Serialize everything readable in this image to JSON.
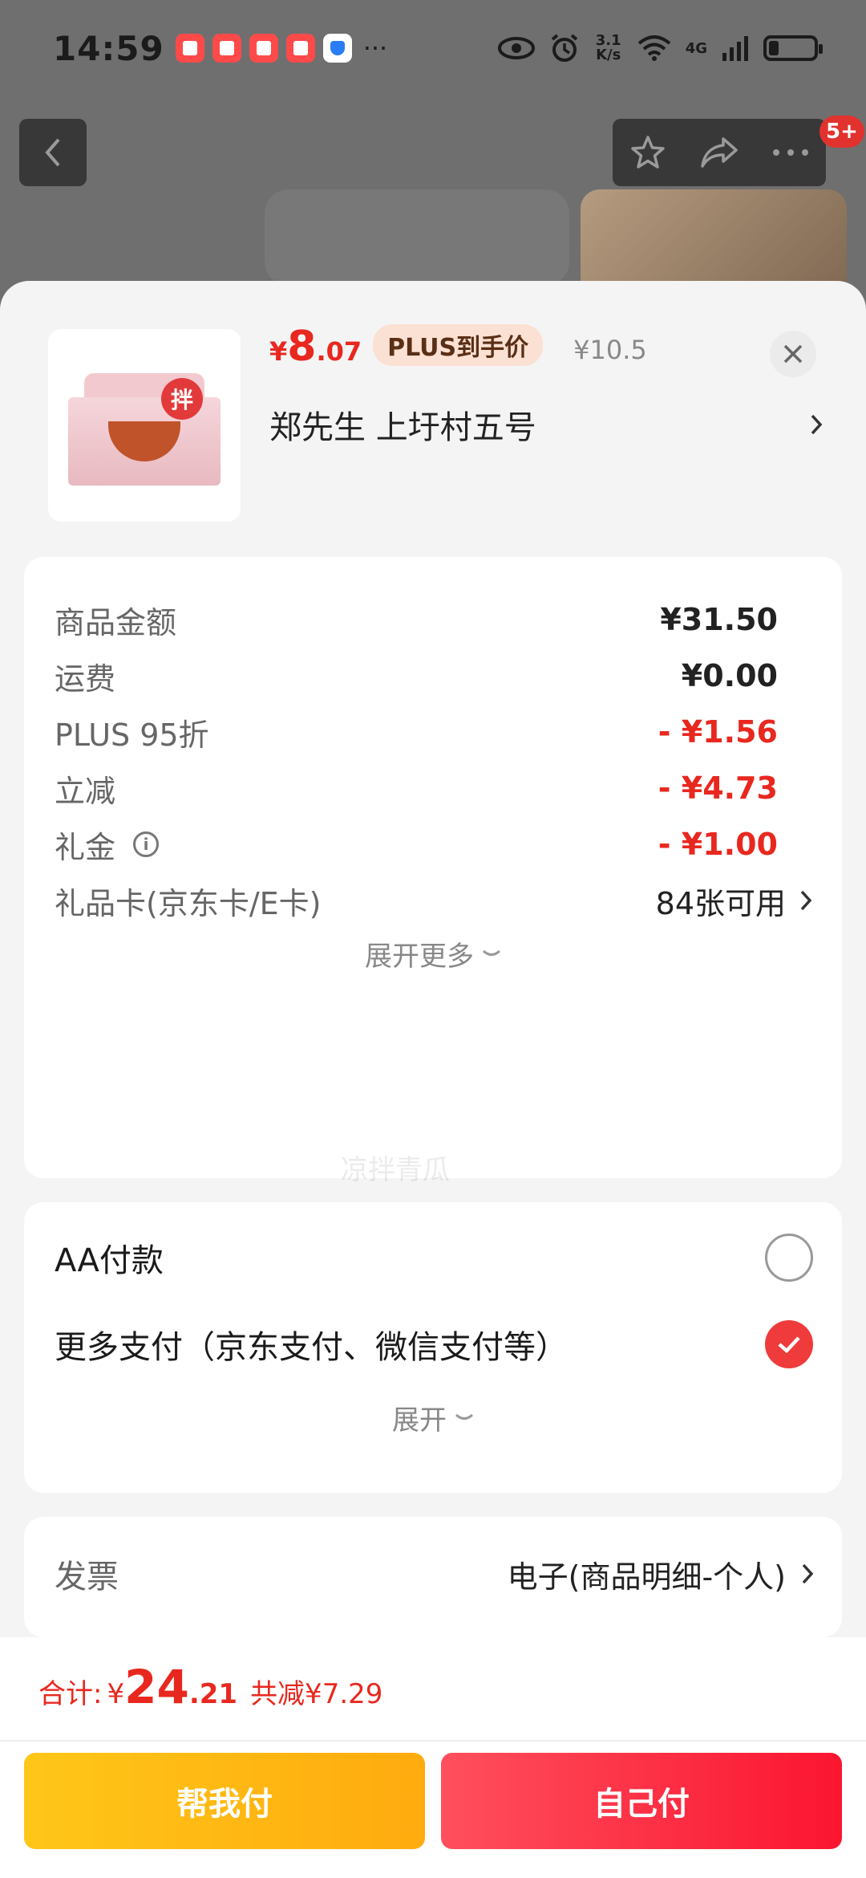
{
  "status_bar": {
    "time": "14:59",
    "more": "···",
    "net_speed": "3.1 K/s",
    "network": "4G"
  },
  "background": {
    "badge": "5+"
  },
  "product": {
    "price_symbol": "¥",
    "price_int": "8",
    "price_dec": ".07",
    "plus_tag": "PLUS到手价",
    "original_price": "¥10.5",
    "address": "郑先生  上圩村五号",
    "seal_text": "拌"
  },
  "summary": {
    "rows": [
      {
        "label": "商品金额",
        "value": "¥31.50"
      },
      {
        "label": "运费",
        "value": "¥0.00"
      },
      {
        "label": "PLUS 95折",
        "value": "- ¥1.56"
      },
      {
        "label": "立减",
        "value": "- ¥4.73"
      },
      {
        "label": "礼金",
        "value": "- ¥1.00"
      }
    ],
    "gift_card_label": "礼品卡(京东卡/E卡)",
    "gift_card_value": "84张可用",
    "expand_more": "展开更多"
  },
  "payment": {
    "aa_label": "AA付款",
    "more_label": "更多支付（京东支付、微信支付等）",
    "expand": "展开"
  },
  "invoice": {
    "label": "发票",
    "value": "电子(商品明细-个人)"
  },
  "footer": {
    "total_label": "合计:",
    "total_symbol": "¥",
    "total_int": "24",
    "total_dec": ".21",
    "saved": "共减¥7.29",
    "help_pay": "帮我付",
    "self_pay": "自己付"
  },
  "watermark": "凉拌青瓜",
  "colors": {
    "accent_red": "#e8281f",
    "button_yellow": "#ffb813",
    "button_red": "#fb2a3e"
  }
}
